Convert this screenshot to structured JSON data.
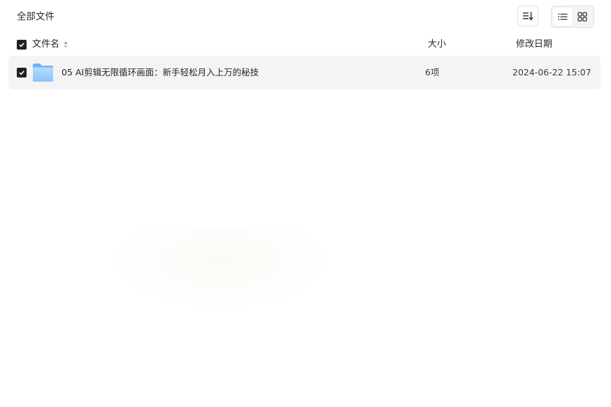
{
  "header": {
    "breadcrumb": "全部文件",
    "sort_icon": "sort-lines-icon",
    "view_modes": [
      {
        "name": "list",
        "icon": "list-view-icon",
        "active": true
      },
      {
        "name": "grid",
        "icon": "grid-view-icon",
        "active": false
      }
    ]
  },
  "columns": {
    "name": "文件名",
    "size": "大小",
    "modified": "修改日期"
  },
  "files": [
    {
      "name": "05 AI剪辑无限循环画面：新手轻松月入上万的秘技",
      "size": "6项",
      "modified": "2024-06-22 15:07",
      "type": "folder",
      "checked": true
    }
  ],
  "colors": {
    "checkbox": "#1f2023",
    "row_bg": "#f4f4f5",
    "folder_light": "#a9d4fb",
    "folder_dark": "#6fb3f2"
  }
}
